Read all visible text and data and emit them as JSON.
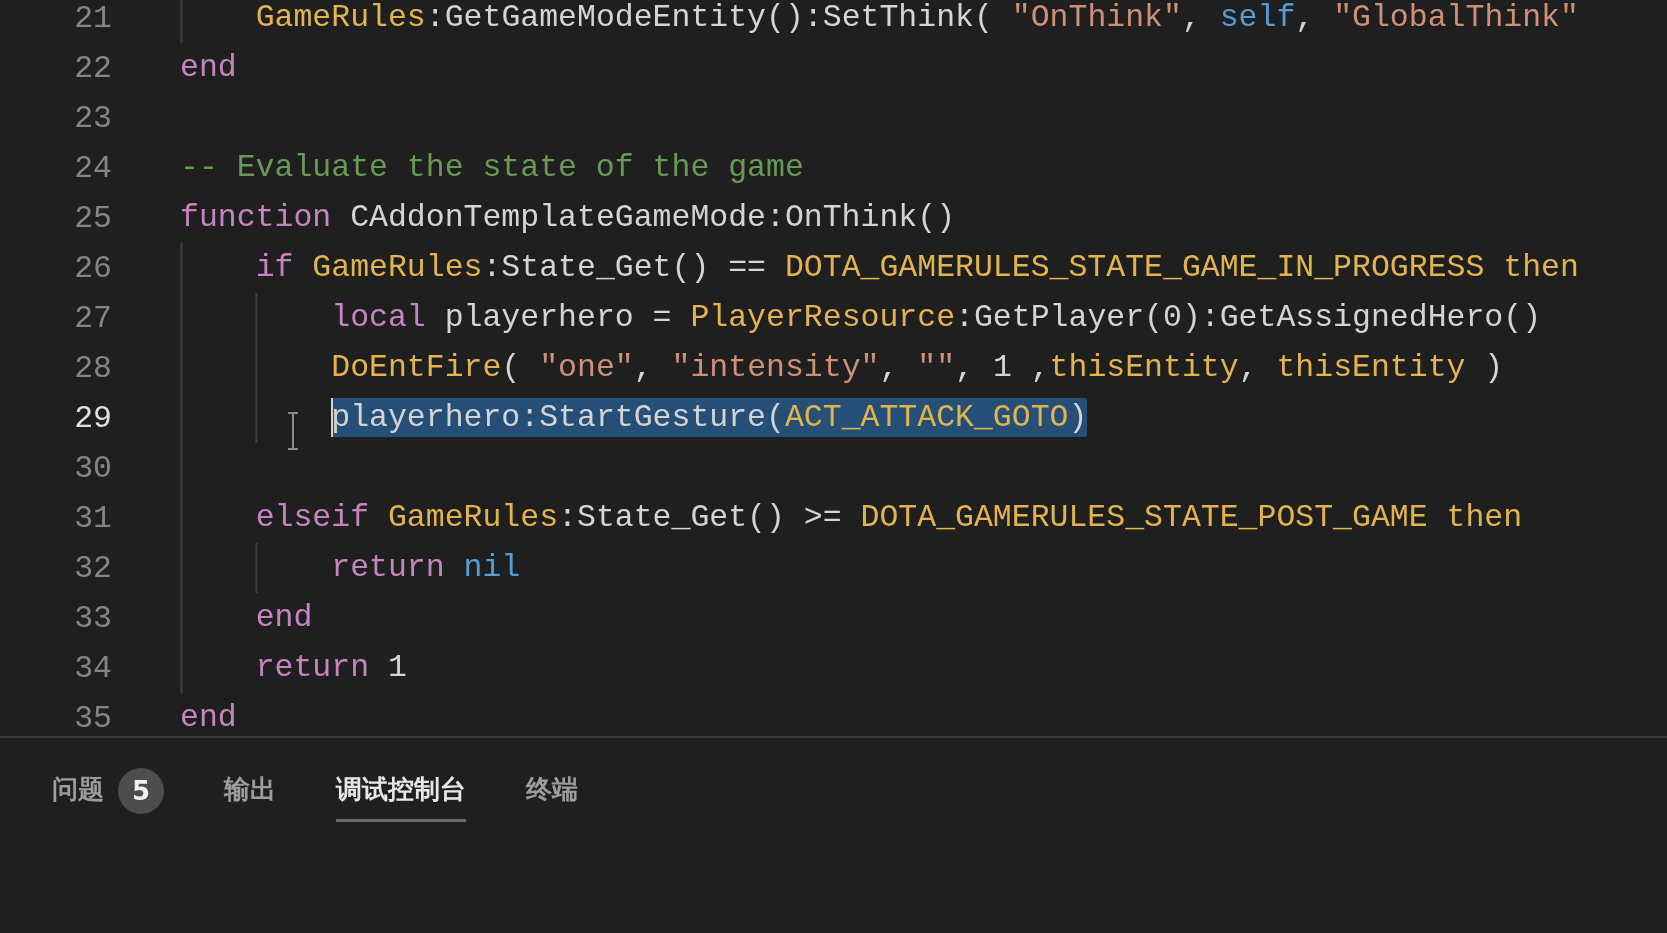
{
  "editor": {
    "lines": [
      {
        "number": "21",
        "selected": false,
        "tokens": [
          {
            "kind": "global",
            "text": "    GameRules"
          },
          {
            "kind": "plain",
            "text": ":GetGameModeEntity():SetThink( "
          },
          {
            "kind": "string",
            "text": "\"OnThink\""
          },
          {
            "kind": "plain",
            "text": ", "
          },
          {
            "kind": "builtin",
            "text": "self"
          },
          {
            "kind": "plain",
            "text": ", "
          },
          {
            "kind": "string",
            "text": "\"GlobalThink\""
          }
        ]
      },
      {
        "number": "22",
        "selected": false,
        "tokens": [
          {
            "kind": "keyword",
            "text": "end"
          }
        ]
      },
      {
        "number": "23",
        "selected": false
      },
      {
        "number": "24",
        "selected": false,
        "tokens": [
          {
            "kind": "comment",
            "text": "-- Evaluate the state of the game"
          }
        ]
      },
      {
        "number": "25",
        "selected": false,
        "tokens": [
          {
            "kind": "keyword",
            "text": "function"
          },
          {
            "kind": "plain",
            "text": " CAddonTemplateGameMode:OnThink()"
          }
        ]
      },
      {
        "number": "26",
        "selected": false,
        "tokens": [
          {
            "kind": "keyword",
            "text": "    if"
          },
          {
            "kind": "global",
            "text": " GameRules"
          },
          {
            "kind": "plain",
            "text": ":State_Get() == "
          },
          {
            "kind": "global",
            "text": "DOTA_GAMERULES_STATE_GAME_IN_PROGRESS then"
          }
        ]
      },
      {
        "number": "27",
        "selected": false,
        "tokens": [
          {
            "kind": "keyword",
            "text": "        local"
          },
          {
            "kind": "plain",
            "text": " playerhero = "
          },
          {
            "kind": "global",
            "text": "PlayerResource"
          },
          {
            "kind": "plain",
            "text": ":GetPlayer(0):GetAssignedHero()"
          }
        ]
      },
      {
        "number": "28",
        "selected": false,
        "tokens": [
          {
            "kind": "global",
            "text": "        DoEntFire"
          },
          {
            "kind": "plain",
            "text": "( "
          },
          {
            "kind": "string",
            "text": "\"one\""
          },
          {
            "kind": "plain",
            "text": ", "
          },
          {
            "kind": "string",
            "text": "\"intensity\""
          },
          {
            "kind": "plain",
            "text": ", "
          },
          {
            "kind": "string",
            "text": "\"\""
          },
          {
            "kind": "plain",
            "text": ", 1 ,"
          },
          {
            "kind": "global",
            "text": "thisEntity"
          },
          {
            "kind": "plain",
            "text": ", "
          },
          {
            "kind": "global",
            "text": "thisEntity"
          },
          {
            "kind": "plain",
            "text": " )"
          }
        ]
      },
      {
        "number": "29",
        "selected": true,
        "tokens": [
          {
            "kind": "plain",
            "text": "        playerhero:StartGesture("
          },
          {
            "kind": "global",
            "text": "ACT_ATTACK_GOTO"
          },
          {
            "kind": "plain",
            "text": ")"
          }
        ]
      },
      {
        "number": "30",
        "selected": false
      },
      {
        "number": "31",
        "selected": false,
        "tokens": [
          {
            "kind": "keyword",
            "text": "    elseif"
          },
          {
            "kind": "global",
            "text": " GameRules"
          },
          {
            "kind": "plain",
            "text": ":State_Get() >= "
          },
          {
            "kind": "global",
            "text": "DOTA_GAMERULES_STATE_POST_GAME then"
          }
        ]
      },
      {
        "number": "32",
        "selected": false,
        "tokens": [
          {
            "kind": "keyword",
            "text": "        return"
          },
          {
            "kind": "builtin",
            "text": " nil"
          }
        ]
      },
      {
        "number": "33",
        "selected": false,
        "tokens": [
          {
            "kind": "keyword",
            "text": "    end"
          }
        ]
      },
      {
        "number": "34",
        "selected": false,
        "tokens": [
          {
            "kind": "keyword",
            "text": "    return"
          },
          {
            "kind": "plain",
            "text": " 1"
          }
        ]
      },
      {
        "number": "35",
        "selected": false,
        "tokens": [
          {
            "kind": "keyword",
            "text": "end"
          }
        ]
      }
    ]
  },
  "panel": {
    "tabs": [
      {
        "label": "问题",
        "selected": false,
        "badge": "5"
      },
      {
        "label": "输出",
        "selected": false
      },
      {
        "label": "调试控制台",
        "selected": true
      },
      {
        "label": "终端",
        "selected": false
      }
    ]
  }
}
